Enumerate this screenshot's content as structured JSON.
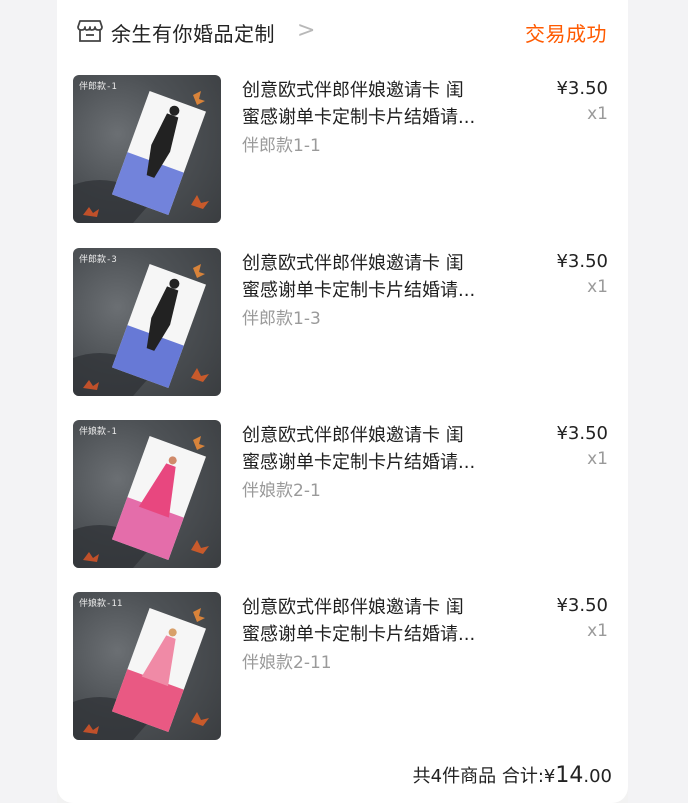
{
  "shop": {
    "name": "余生有你婚品定制",
    "status": "交易成功",
    "icon": "shop-icon",
    "chevron": ">"
  },
  "colors": {
    "accent": "#ff5a00",
    "muted": "#9a9a9a"
  },
  "items": [
    {
      "thumb_label": "伴郎款-1",
      "title_line1": "创意欧式伴郎伴娘邀请卡 闺",
      "title_line2": "蜜感谢单卡定制卡片结婚请...",
      "sku": "伴郎款1-1",
      "price": "¥3.50",
      "qty": "x1",
      "card_color": "blue"
    },
    {
      "thumb_label": "伴郎款-3",
      "title_line1": "创意欧式伴郎伴娘邀请卡 闺",
      "title_line2": "蜜感谢单卡定制卡片结婚请...",
      "sku": "伴郎款1-3",
      "price": "¥3.50",
      "qty": "x1",
      "card_color": "blue"
    },
    {
      "thumb_label": "伴娘款-1",
      "title_line1": "创意欧式伴郎伴娘邀请卡 闺",
      "title_line2": "蜜感谢单卡定制卡片结婚请...",
      "sku": "伴娘款2-1",
      "price": "¥3.50",
      "qty": "x1",
      "card_color": "pink"
    },
    {
      "thumb_label": "伴娘款-11",
      "title_line1": "创意欧式伴郎伴娘邀请卡 闺",
      "title_line2": "蜜感谢单卡定制卡片结婚请...",
      "sku": "伴娘款2-11",
      "price": "¥3.50",
      "qty": "x1",
      "card_color": "pink"
    }
  ],
  "footer": {
    "count_text": "共4件商品",
    "total_label": "合计:",
    "currency": "¥",
    "total_int": "14",
    "total_dec": ".00"
  }
}
